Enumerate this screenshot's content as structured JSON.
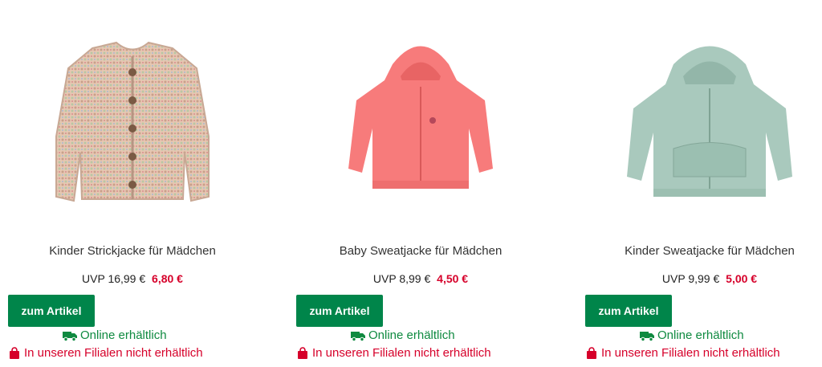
{
  "products": [
    {
      "name": "Kinder Strickjacke für Mädchen",
      "uvp": "UVP 16,99 €",
      "sale": "6,80 €",
      "button": "zum Artikel",
      "online": "Online erhältlich",
      "store": "In unseren Filialen nicht erhältlich",
      "image": "knit-cardigan"
    },
    {
      "name": "Baby Sweatjacke für Mädchen",
      "uvp": "UVP 8,99 €",
      "sale": "4,50 €",
      "button": "zum Artikel",
      "online": "Online erhältlich",
      "store": "In unseren Filialen nicht erhältlich",
      "image": "pink-hoodie"
    },
    {
      "name": "Kinder Sweatjacke für Mädchen",
      "uvp": "UVP 9,99 €",
      "sale": "5,00 €",
      "button": "zum Artikel",
      "online": "Online erhältlich",
      "store": "In unseren Filialen nicht erhältlich",
      "image": "mint-hoodie"
    }
  ],
  "colors": {
    "button": "#00854a",
    "online": "#0f8a40",
    "sale": "#d6002a",
    "pink": "#f77b7b",
    "mint": "#a9c9bd",
    "knit": "#e3c3ad"
  }
}
